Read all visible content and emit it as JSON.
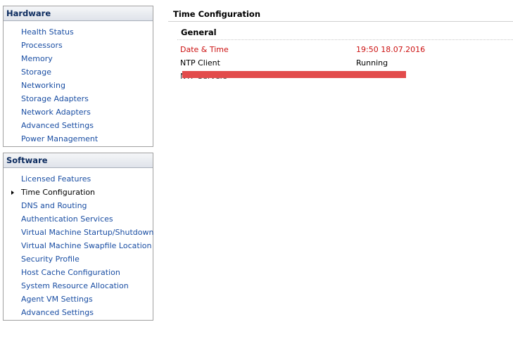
{
  "hardware": {
    "title": "Hardware",
    "items": [
      {
        "label": "Health Status"
      },
      {
        "label": "Processors"
      },
      {
        "label": "Memory"
      },
      {
        "label": "Storage"
      },
      {
        "label": "Networking"
      },
      {
        "label": "Storage Adapters"
      },
      {
        "label": "Network Adapters"
      },
      {
        "label": "Advanced Settings"
      },
      {
        "label": "Power Management"
      }
    ]
  },
  "software": {
    "title": "Software",
    "items": [
      {
        "label": "Licensed Features"
      },
      {
        "label": "Time Configuration",
        "selected": true
      },
      {
        "label": "DNS and Routing"
      },
      {
        "label": "Authentication Services"
      },
      {
        "label": "Virtual Machine Startup/Shutdown"
      },
      {
        "label": "Virtual Machine Swapfile Location"
      },
      {
        "label": "Security Profile"
      },
      {
        "label": "Host Cache Configuration"
      },
      {
        "label": "System Resource Allocation"
      },
      {
        "label": "Agent VM Settings"
      },
      {
        "label": "Advanced Settings"
      }
    ]
  },
  "content": {
    "title": "Time Configuration",
    "section": "General",
    "rows": {
      "datetime": {
        "label": "Date & Time",
        "value": "19:50  18.07.2016"
      },
      "ntpclient": {
        "label": "NTP Client",
        "value": "Running"
      },
      "ntpservers": {
        "label": "NTP Servers",
        "value": ""
      }
    }
  },
  "colors": {
    "link": "#1a4ea3",
    "highlight_row": "#cc1111",
    "redaction": "#e24b4b"
  }
}
